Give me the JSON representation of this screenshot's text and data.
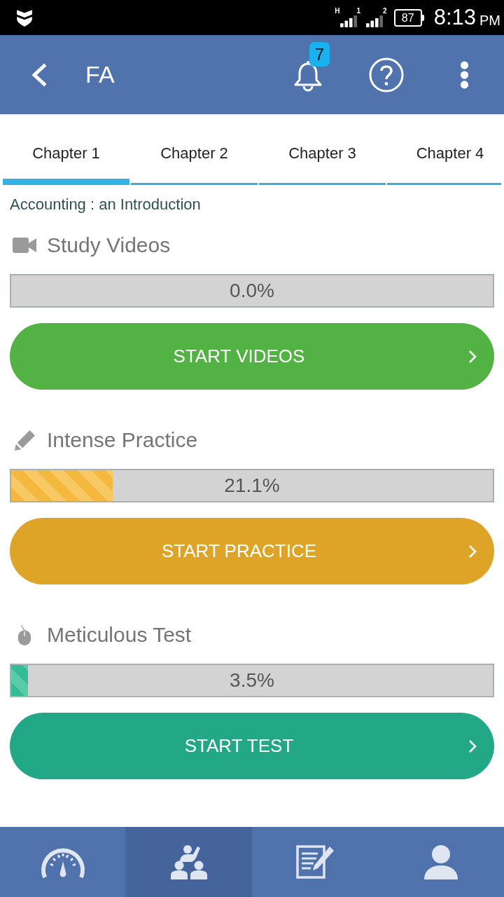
{
  "status_bar": {
    "signals": [
      {
        "network": "H",
        "sim": "1"
      },
      {
        "sim": "2"
      }
    ],
    "battery": "87",
    "time": "8:13",
    "meridiem": "PM"
  },
  "app_bar": {
    "title": "FA",
    "notification_count": "7"
  },
  "tabs": [
    {
      "label": "Chapter 1",
      "selected": true
    },
    {
      "label": "Chapter 2",
      "selected": false
    },
    {
      "label": "Chapter 3",
      "selected": false
    },
    {
      "label": "Chapter 4",
      "selected": false
    }
  ],
  "subtitle": "Accounting : an Introduction",
  "sections": [
    {
      "kind": "videos",
      "title": "Study Videos",
      "reading": "0.0%",
      "button": "START VIDEOS",
      "color": "#52b244"
    },
    {
      "kind": "practice",
      "title": "Intense Practice",
      "level": 0.211,
      "reading": "21.1%",
      "button": "START PRACTICE",
      "color": "#dea428"
    },
    {
      "kind": "test",
      "title": "Meticulous Test",
      "level": 0.035,
      "reading": "3.5%",
      "button": "START TEST",
      "color": "#22a887"
    }
  ],
  "bottom_nav": [
    {
      "kind": "dashboard",
      "selected": false
    },
    {
      "kind": "classroom",
      "selected": true
    },
    {
      "kind": "notes",
      "selected": false
    },
    {
      "kind": "profile",
      "selected": false
    }
  ]
}
